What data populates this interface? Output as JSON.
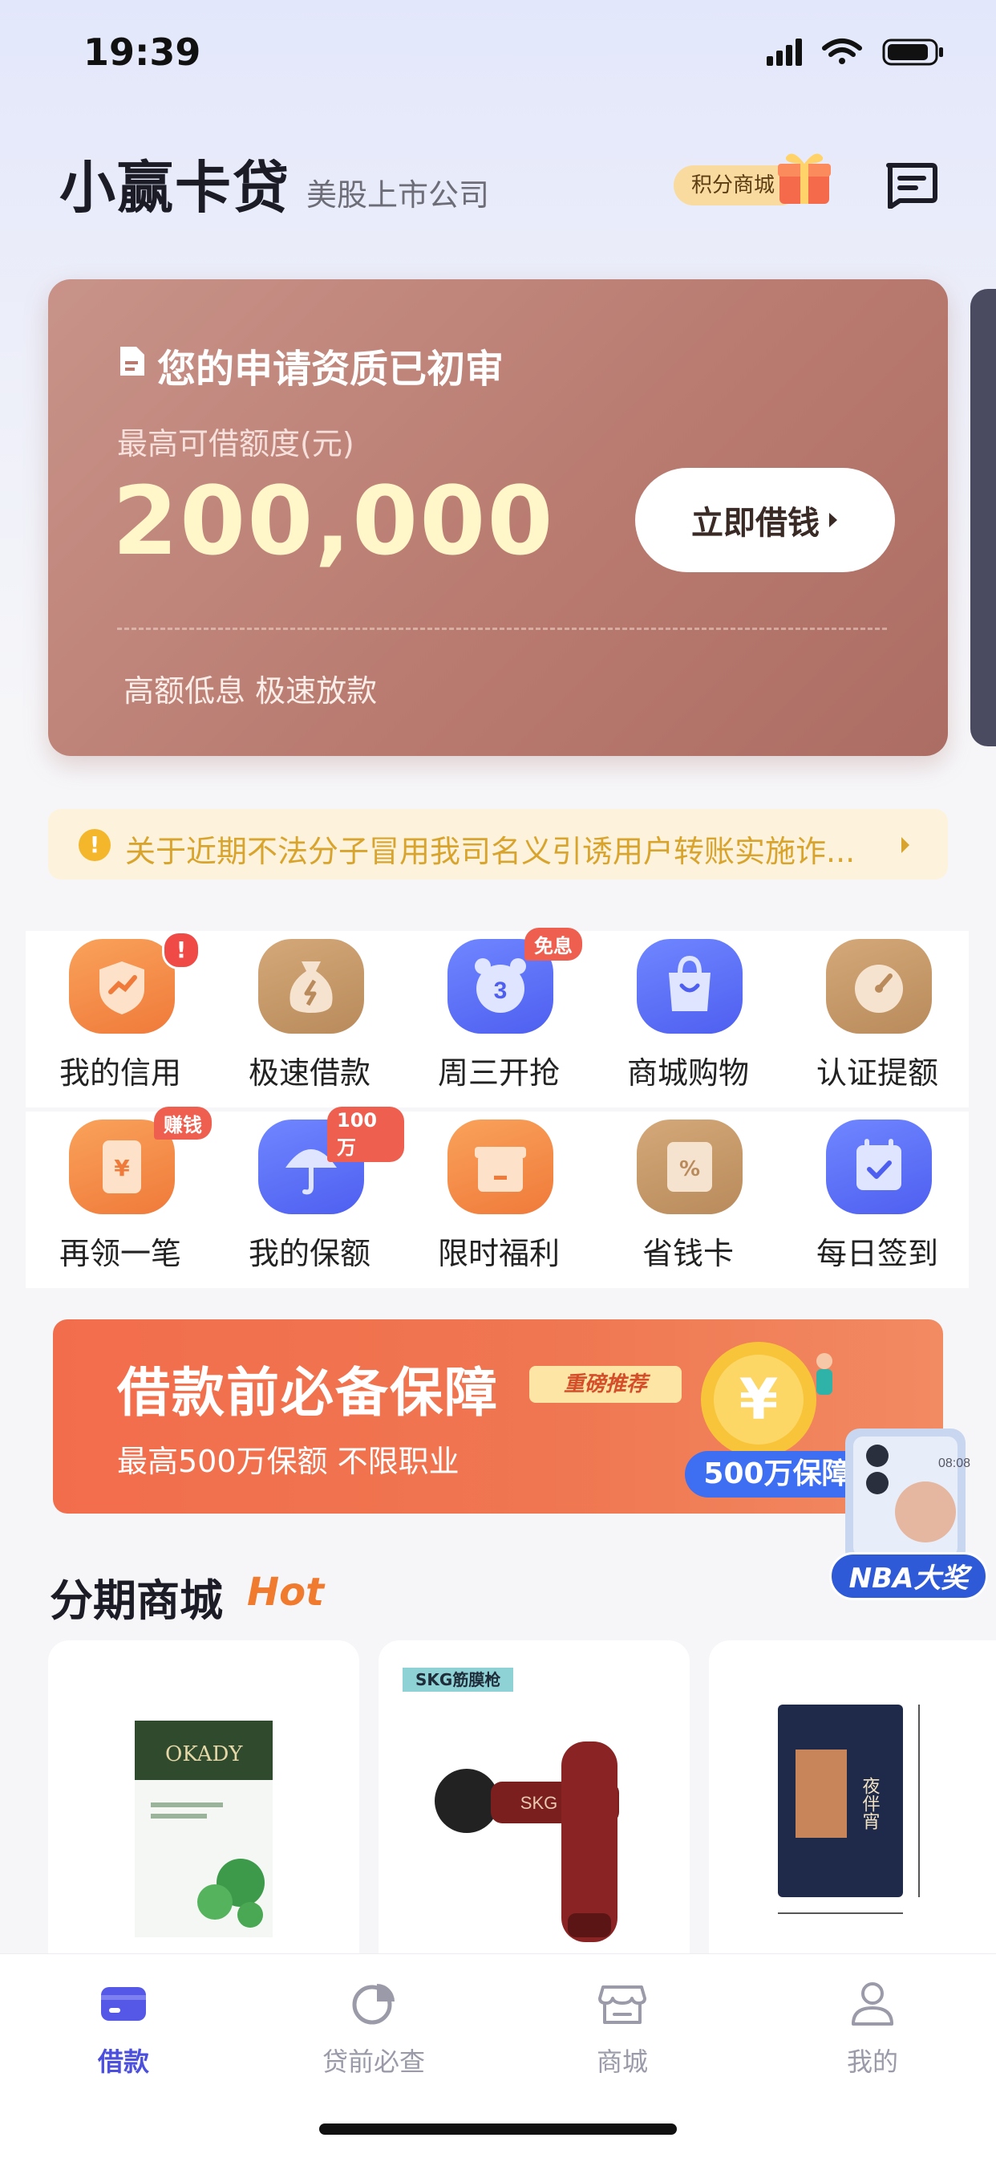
{
  "status_bar": {
    "time": "19:39"
  },
  "header": {
    "app_name": "小赢卡贷",
    "subtitle": "美股上市公司",
    "points_mall": "积分商城"
  },
  "loan_card": {
    "title": "您的申请资质已初审",
    "limit_label": "最高可借额度(元)",
    "amount": "200,000",
    "cta": "立即借钱",
    "slogan": "高额低息 极速放款"
  },
  "notice": {
    "text": "关于近期不法分子冒用我司名义引诱用户转账实施诈..."
  },
  "features": [
    {
      "label": "我的信用",
      "badge": "!",
      "icon": "shield-chart-icon",
      "color": "#f58a48"
    },
    {
      "label": "极速借款",
      "badge": "",
      "icon": "money-bag-icon",
      "color": "#c79a6a"
    },
    {
      "label": "周三开抢",
      "badge": "免息",
      "icon": "alarm-clock-icon",
      "color": "#5b6cf6"
    },
    {
      "label": "商城购物",
      "badge": "",
      "icon": "shopping-bag-icon",
      "color": "#5b6cf6"
    },
    {
      "label": "认证提额",
      "badge": "",
      "icon": "gauge-icon",
      "color": "#c79a6a"
    },
    {
      "label": "再领一笔",
      "badge": "赚钱",
      "icon": "yuan-envelope-icon",
      "color": "#f58a48"
    },
    {
      "label": "我的保额",
      "badge": "100万",
      "icon": "umbrella-icon",
      "color": "#5b6cf6"
    },
    {
      "label": "限时福利",
      "badge": "",
      "icon": "gift-box-icon",
      "color": "#f58a48"
    },
    {
      "label": "省钱卡",
      "badge": "",
      "icon": "discount-card-icon",
      "color": "#c79a6a"
    },
    {
      "label": "每日签到",
      "badge": "",
      "icon": "calendar-check-icon",
      "color": "#5b6cf6"
    }
  ],
  "banner": {
    "title": "借款前必备保障",
    "tag": "重磅推荐",
    "subtitle": "最高500万保额 不限职业",
    "pill": "500万保障",
    "float_label": "NBA大奖"
  },
  "shop": {
    "title": "分期商城",
    "hot": "Hot",
    "products": [
      {
        "name": "OKADY mask",
        "brand_tag": "",
        "logo_text": "OKADY"
      },
      {
        "name": "SKG massage gun",
        "brand_tag": "SKG筋膜枪",
        "logo_text": "SKG"
      },
      {
        "name": "snack bag",
        "brand_tag": "",
        "logo_text": "夜伴宵"
      }
    ]
  },
  "tabbar": [
    {
      "label": "借款",
      "icon": "card-icon",
      "active": true
    },
    {
      "label": "贷前必查",
      "icon": "pie-chart-icon",
      "active": false
    },
    {
      "label": "商城",
      "icon": "store-icon",
      "active": false
    },
    {
      "label": "我的",
      "icon": "person-icon",
      "active": false
    }
  ],
  "colors": {
    "accent": "#4b4fdc",
    "card": "#b8796e",
    "amount": "#fff6c9"
  }
}
